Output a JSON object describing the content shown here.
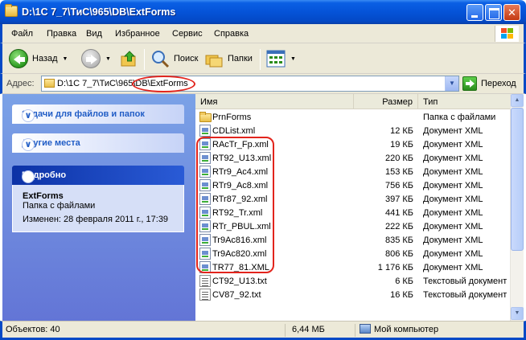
{
  "window": {
    "title": "D:\\1C 7_7\\ТиС\\965\\DB\\ExtForms"
  },
  "menu": [
    "Файл",
    "Правка",
    "Вид",
    "Избранное",
    "Сервис",
    "Справка"
  ],
  "toolbar": {
    "back_label": "Назад",
    "search_label": "Поиск",
    "folders_label": "Папки"
  },
  "address": {
    "label": "Адрес:",
    "path": "D:\\1C 7_7\\ТиС\\965\\DB\\ExtForms",
    "go_label": "Переход"
  },
  "taskpane": {
    "file_tasks": "Задачи для файлов и папок",
    "other_places": "Другие места",
    "details": {
      "header": "Подробно",
      "name": "ExtForms",
      "kind": "Папка с файлами",
      "modified": "Изменен: 28 февраля 2011 г., 17:39"
    }
  },
  "columns": {
    "name": "Имя",
    "size": "Размер",
    "type": "Тип"
  },
  "files": [
    {
      "name": "PrnForms",
      "size": "",
      "type": "Папка с файлами",
      "icon": "folder"
    },
    {
      "name": "CDList.xml",
      "size": "12 КБ",
      "type": "Документ XML",
      "icon": "xml"
    },
    {
      "name": "RAcTr_Fp.xml",
      "size": "19 КБ",
      "type": "Документ XML",
      "icon": "xml"
    },
    {
      "name": "RT92_U13.xml",
      "size": "220 КБ",
      "type": "Документ XML",
      "icon": "xml"
    },
    {
      "name": "RTr9_Ac4.xml",
      "size": "153 КБ",
      "type": "Документ XML",
      "icon": "xml"
    },
    {
      "name": "RTr9_Ac8.xml",
      "size": "756 КБ",
      "type": "Документ XML",
      "icon": "xml"
    },
    {
      "name": "RTr87_92.xml",
      "size": "397 КБ",
      "type": "Документ XML",
      "icon": "xml"
    },
    {
      "name": "RT92_Tr.xml",
      "size": "441 КБ",
      "type": "Документ XML",
      "icon": "xml"
    },
    {
      "name": "RTr_PBUL.xml",
      "size": "222 КБ",
      "type": "Документ XML",
      "icon": "xml"
    },
    {
      "name": "Tr9Ac816.xml",
      "size": "835 КБ",
      "type": "Документ XML",
      "icon": "xml"
    },
    {
      "name": "Tr9Ac820.xml",
      "size": "806 КБ",
      "type": "Документ XML",
      "icon": "xml"
    },
    {
      "name": "TR77_81.XML",
      "size": "1 176 КБ",
      "type": "Документ XML",
      "icon": "xml"
    },
    {
      "name": "CT92_U13.txt",
      "size": "6 КБ",
      "type": "Текстовый документ",
      "icon": "txt"
    },
    {
      "name": "CV87_92.txt",
      "size": "16 КБ",
      "type": "Текстовый документ",
      "icon": "txt"
    }
  ],
  "status": {
    "objects": "Объектов: 40",
    "size": "6,44 МБ",
    "location": "Мой компьютер"
  },
  "colors": {
    "xp_blue": "#0449c6",
    "annotation_red": "#e2241c"
  }
}
